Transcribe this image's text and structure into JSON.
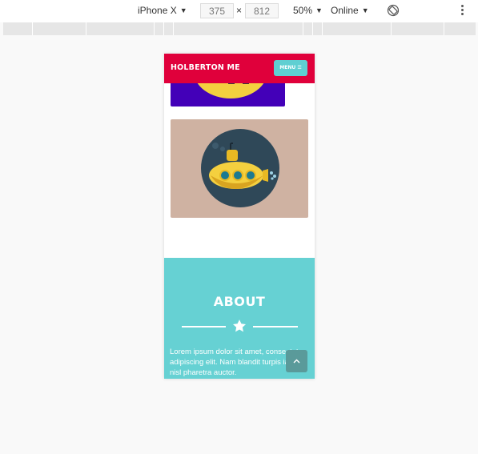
{
  "toolbar": {
    "device": "iPhone X",
    "width": "375",
    "separator": "×",
    "height": "812",
    "zoom": "50%",
    "throttle": "Online",
    "icons": [
      "caret-down-icon",
      "rotate-icon",
      "more-vert-icon"
    ]
  },
  "site": {
    "brand": "HOLBERTON ME",
    "menu_label": "MENU ☰",
    "about_title": "ABOUT",
    "about_text": "Lorem ipsum dolor sit amet, consectetur adipiscing elit. Nam blandit turpis iaculis nisl pharetra auctor.",
    "colors": {
      "nav": "#e0003b",
      "accent": "#66d1d3",
      "card_top": "#4300b8",
      "card_sub": "#cfb2a2",
      "submarine_circle": "#2f4858",
      "submarine_body": "#f4d03f"
    }
  }
}
